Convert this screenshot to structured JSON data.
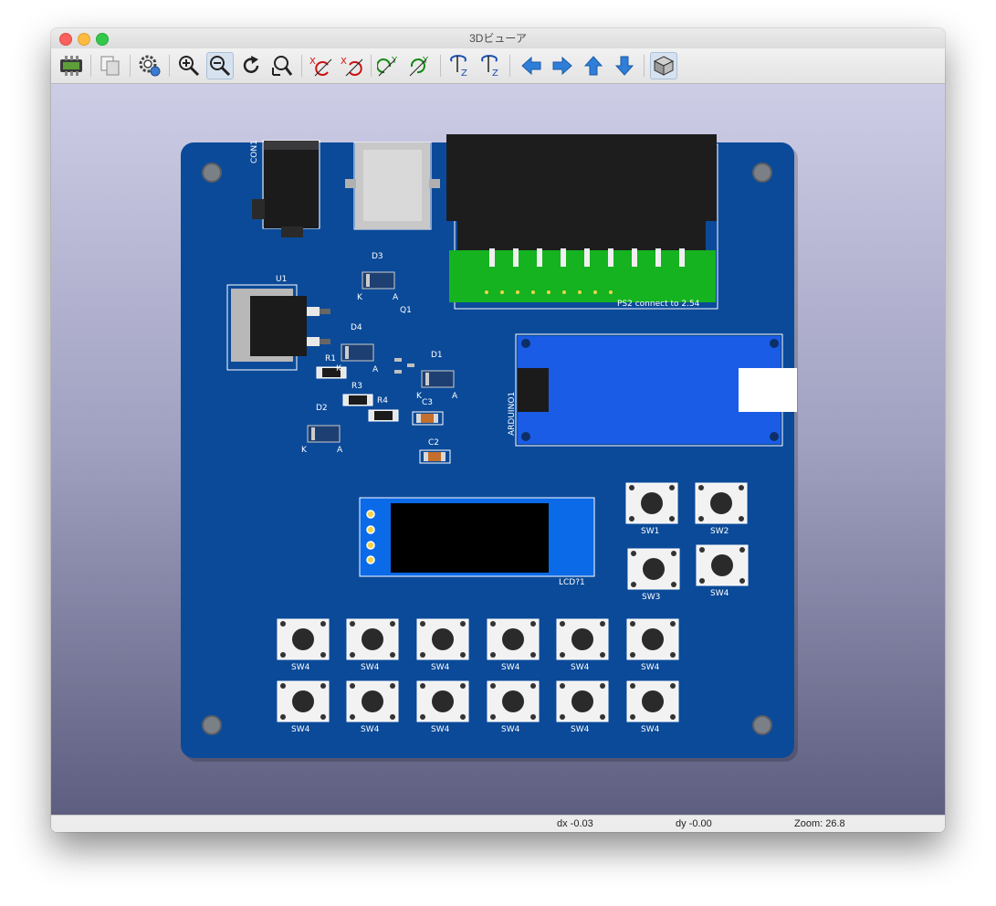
{
  "window": {
    "title": "3Dビューア"
  },
  "toolbar": {
    "buttons": [
      {
        "name": "render-icon",
        "active": false
      },
      {
        "name": "copy-icon",
        "active": false
      },
      {
        "name": "settings-icon",
        "active": false
      },
      {
        "name": "zoom-in-icon",
        "active": false
      },
      {
        "name": "zoom-out-icon",
        "active": true
      },
      {
        "name": "redraw-icon",
        "active": false
      },
      {
        "name": "zoom-fit-icon",
        "active": false
      },
      {
        "name": "rotate-x-cw-icon",
        "active": false
      },
      {
        "name": "rotate-x-ccw-icon",
        "active": false
      },
      {
        "name": "rotate-y-cw-icon",
        "active": false
      },
      {
        "name": "rotate-y-ccw-icon",
        "active": false
      },
      {
        "name": "rotate-z-cw-icon",
        "active": false
      },
      {
        "name": "rotate-z-ccw-icon",
        "active": false
      },
      {
        "name": "move-left-icon",
        "active": false
      },
      {
        "name": "move-right-icon",
        "active": false
      },
      {
        "name": "move-up-icon",
        "active": false
      },
      {
        "name": "move-down-icon",
        "active": false
      },
      {
        "name": "ortho-view-icon",
        "active": true
      }
    ],
    "axis_labels": {
      "x": "X",
      "y": "Y",
      "z": "Z"
    }
  },
  "board": {
    "labels": {
      "con1": "CON1",
      "u1": "U1",
      "d3": "D3",
      "d4": "D4",
      "d1": "D1",
      "d2": "D2",
      "q1": "Q1",
      "r1": "R1",
      "r3": "R3",
      "r4": "R4",
      "c3": "C3",
      "c2": "C2",
      "k": "K",
      "a": "A",
      "ps2": "PS2 connect to 2.54",
      "arduino": "ARDUINO1",
      "lcd": "LCD?1",
      "sw1": "SW1",
      "sw2": "SW2",
      "sw3": "SW3",
      "sw4": "SW4"
    }
  },
  "colors": {
    "board": "#0b4a99",
    "arduino": "#1a5ce6",
    "connector_green": "#14b41e",
    "lcd_module": "#0a6ae8"
  },
  "status": {
    "dx": "dx -0.03",
    "dy": "dy -0.00",
    "zoom": "Zoom: 26.8"
  }
}
